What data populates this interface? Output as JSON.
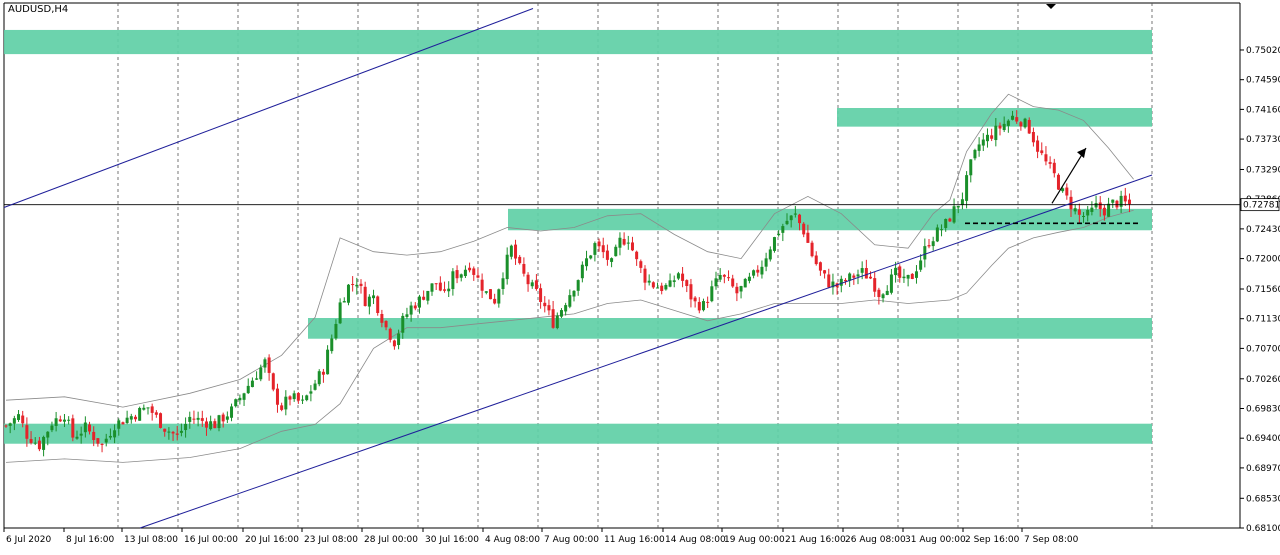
{
  "window": {
    "symbol_label": "AUDUSD,H4"
  },
  "colors": {
    "background": "#ffffff",
    "bull_candle": "#1a8f2a",
    "bear_candle": "#e4232a",
    "zone_fill": "#5fcfa6",
    "trendline": "#1f1f9a",
    "bollinger": "#8a8a8a",
    "grid": "#555555",
    "axis_text": "#000000"
  },
  "chart_data": {
    "type": "candlestick",
    "title": "AUDUSD,H4",
    "ylim": [
      0.681,
      0.757
    ],
    "grid": true,
    "y_ticks": [
      "0.75020",
      "0.74590",
      "0.74160",
      "0.73730",
      "0.73290",
      "0.72860",
      "0.72430",
      "0.72000",
      "0.71560",
      "0.71130",
      "0.70700",
      "0.70260",
      "0.69830",
      "0.69400",
      "0.68970",
      "0.68530",
      "0.68100"
    ],
    "x_ticks": [
      "6 Jul 2020",
      "8 Jul 16:00",
      "13 Jul 08:00",
      "16 Jul 00:00",
      "20 Jul 16:00",
      "23 Jul 08:00",
      "28 Jul 00:00",
      "30 Jul 16:00",
      "4 Aug 08:00",
      "7 Aug 00:00",
      "11 Aug 16:00",
      "14 Aug 08:00",
      "19 Aug 00:00",
      "21 Aug 16:00",
      "26 Aug 08:00",
      "31 Aug 00:00",
      "2 Sep 16:00",
      "7 Sep 08:00"
    ],
    "current_price": "0.72781",
    "horizontal_line": 0.72781,
    "zones": [
      {
        "name": "resistance-top",
        "low": 0.7496,
        "high": 0.7531
      },
      {
        "name": "resistance-high",
        "low": 0.7391,
        "high": 0.7418
      },
      {
        "name": "support-mid",
        "low": 0.7241,
        "high": 0.7272
      },
      {
        "name": "support-lower",
        "low": 0.7084,
        "high": 0.7114
      },
      {
        "name": "support-bottom",
        "low": 0.6932,
        "high": 0.6961
      }
    ],
    "trendlines": [
      {
        "name": "upper-channel",
        "points": [
          [
            "6 Jul 2020",
            0.7274
          ],
          [
            "30 Jul 16:00",
            0.7562
          ]
        ]
      },
      {
        "name": "lower-channel",
        "points": [
          [
            "13 Jul 08:00",
            0.681
          ],
          [
            "7 Sep 08:00",
            0.7321
          ]
        ]
      }
    ],
    "dashed_level": {
      "price": 0.7251,
      "from": "2 Sep 16:00",
      "to": "7 Sep 08:00"
    },
    "arrow": {
      "from": [
        "7 Sep 08:00",
        0.728
      ],
      "to": [
        "7 Sep 08:00",
        0.736
      ]
    },
    "close_path": [
      [
        0,
        0.6958
      ],
      [
        3,
        0.6972
      ],
      [
        5,
        0.6945
      ],
      [
        8,
        0.693
      ],
      [
        11,
        0.6963
      ],
      [
        14,
        0.6975
      ],
      [
        16,
        0.6942
      ],
      [
        19,
        0.6955
      ],
      [
        23,
        0.693
      ],
      [
        26,
        0.696
      ],
      [
        30,
        0.6972
      ],
      [
        34,
        0.6985
      ],
      [
        38,
        0.6955
      ],
      [
        41,
        0.6942
      ],
      [
        44,
        0.697
      ],
      [
        47,
        0.6965
      ],
      [
        50,
        0.696
      ],
      [
        54,
        0.698
      ],
      [
        57,
        0.7008
      ],
      [
        59,
        0.7025
      ],
      [
        62,
        0.705
      ],
      [
        64,
        0.7005
      ],
      [
        66,
        0.6985
      ],
      [
        68,
        0.7
      ],
      [
        71,
        0.699
      ],
      [
        74,
        0.702
      ],
      [
        76,
        0.704
      ],
      [
        78,
        0.7085
      ],
      [
        80,
        0.7135
      ],
      [
        82,
        0.716
      ],
      [
        84,
        0.7168
      ],
      [
        86,
        0.714
      ],
      [
        88,
        0.7145
      ],
      [
        91,
        0.71
      ],
      [
        93,
        0.708
      ],
      [
        95,
        0.711
      ],
      [
        97,
        0.713
      ],
      [
        99,
        0.714
      ],
      [
        101,
        0.7155
      ],
      [
        103,
        0.7165
      ],
      [
        105,
        0.7145
      ],
      [
        107,
        0.7175
      ],
      [
        109,
        0.718
      ],
      [
        111,
        0.7192
      ],
      [
        113,
        0.717
      ],
      [
        115,
        0.715
      ],
      [
        117,
        0.714
      ],
      [
        119,
        0.718
      ],
      [
        121,
        0.7215
      ],
      [
        123,
        0.7185
      ],
      [
        125,
        0.7165
      ],
      [
        127,
        0.715
      ],
      [
        129,
        0.713
      ],
      [
        131,
        0.7108
      ],
      [
        133,
        0.7128
      ],
      [
        135,
        0.715
      ],
      [
        137,
        0.7172
      ],
      [
        139,
        0.7198
      ],
      [
        141,
        0.722
      ],
      [
        143,
        0.7208
      ],
      [
        145,
        0.7192
      ],
      [
        147,
        0.7225
      ],
      [
        149,
        0.723
      ],
      [
        151,
        0.7195
      ],
      [
        153,
        0.7172
      ],
      [
        155,
        0.7162
      ],
      [
        157,
        0.7158
      ],
      [
        159,
        0.716
      ],
      [
        161,
        0.718
      ],
      [
        163,
        0.7155
      ],
      [
        165,
        0.7135
      ],
      [
        167,
        0.7132
      ],
      [
        169,
        0.7155
      ],
      [
        171,
        0.7175
      ],
      [
        173,
        0.7165
      ],
      [
        175,
        0.715
      ],
      [
        177,
        0.7162
      ],
      [
        179,
        0.7175
      ],
      [
        181,
        0.7192
      ],
      [
        183,
        0.7218
      ],
      [
        185,
        0.724
      ],
      [
        187,
        0.7255
      ],
      [
        189,
        0.7262
      ],
      [
        191,
        0.724
      ],
      [
        193,
        0.7205
      ],
      [
        195,
        0.718
      ],
      [
        197,
        0.7165
      ],
      [
        199,
        0.716
      ],
      [
        201,
        0.7168
      ],
      [
        203,
        0.7175
      ],
      [
        205,
        0.718
      ],
      [
        207,
        0.7172
      ],
      [
        209,
        0.715
      ],
      [
        211,
        0.7162
      ],
      [
        213,
        0.7178
      ],
      [
        215,
        0.7165
      ],
      [
        217,
        0.7175
      ],
      [
        219,
        0.72
      ],
      [
        221,
        0.7225
      ],
      [
        223,
        0.7238
      ],
      [
        225,
        0.725
      ],
      [
        227,
        0.727
      ],
      [
        229,
        0.729
      ],
      [
        231,
        0.7335
      ],
      [
        233,
        0.7365
      ],
      [
        235,
        0.7375
      ],
      [
        237,
        0.7385
      ],
      [
        239,
        0.7395
      ],
      [
        241,
        0.7405
      ],
      [
        243,
        0.74
      ],
      [
        245,
        0.7388
      ],
      [
        247,
        0.736
      ],
      [
        249,
        0.7338
      ],
      [
        251,
        0.732
      ],
      [
        253,
        0.7295
      ],
      [
        255,
        0.7278
      ],
      [
        257,
        0.7262
      ],
      [
        259,
        0.7262
      ],
      [
        261,
        0.7275
      ],
      [
        263,
        0.727
      ],
      [
        265,
        0.728
      ],
      [
        267,
        0.7282
      ],
      [
        269,
        0.7278
      ]
    ],
    "bollinger_upper": [
      [
        0,
        0.6995
      ],
      [
        14,
        0.7
      ],
      [
        28,
        0.6985
      ],
      [
        44,
        0.7005
      ],
      [
        56,
        0.7025
      ],
      [
        66,
        0.706
      ],
      [
        74,
        0.7115
      ],
      [
        80,
        0.723
      ],
      [
        88,
        0.721
      ],
      [
        96,
        0.7205
      ],
      [
        104,
        0.721
      ],
      [
        112,
        0.7225
      ],
      [
        120,
        0.7245
      ],
      [
        128,
        0.724
      ],
      [
        136,
        0.7245
      ],
      [
        144,
        0.7262
      ],
      [
        152,
        0.7265
      ],
      [
        160,
        0.7235
      ],
      [
        168,
        0.721
      ],
      [
        176,
        0.72
      ],
      [
        184,
        0.7265
      ],
      [
        192,
        0.729
      ],
      [
        200,
        0.7265
      ],
      [
        208,
        0.722
      ],
      [
        216,
        0.7215
      ],
      [
        222,
        0.7265
      ],
      [
        226,
        0.7285
      ],
      [
        230,
        0.7355
      ],
      [
        236,
        0.741
      ],
      [
        240,
        0.7438
      ],
      [
        246,
        0.742
      ],
      [
        252,
        0.7415
      ],
      [
        258,
        0.74
      ],
      [
        264,
        0.736
      ],
      [
        270,
        0.7315
      ]
    ],
    "bollinger_lower": [
      [
        0,
        0.6905
      ],
      [
        14,
        0.691
      ],
      [
        28,
        0.6905
      ],
      [
        44,
        0.6912
      ],
      [
        56,
        0.6925
      ],
      [
        66,
        0.695
      ],
      [
        74,
        0.696
      ],
      [
        80,
        0.699
      ],
      [
        88,
        0.707
      ],
      [
        96,
        0.71
      ],
      [
        104,
        0.71
      ],
      [
        112,
        0.7105
      ],
      [
        120,
        0.711
      ],
      [
        128,
        0.7115
      ],
      [
        136,
        0.712
      ],
      [
        144,
        0.7135
      ],
      [
        152,
        0.714
      ],
      [
        160,
        0.7125
      ],
      [
        168,
        0.711
      ],
      [
        176,
        0.712
      ],
      [
        184,
        0.7135
      ],
      [
        192,
        0.7135
      ],
      [
        200,
        0.7135
      ],
      [
        208,
        0.714
      ],
      [
        216,
        0.7135
      ],
      [
        222,
        0.7138
      ],
      [
        226,
        0.714
      ],
      [
        230,
        0.715
      ],
      [
        236,
        0.719
      ],
      [
        240,
        0.7215
      ],
      [
        246,
        0.723
      ],
      [
        252,
        0.7238
      ],
      [
        258,
        0.7245
      ],
      [
        264,
        0.726
      ],
      [
        270,
        0.727
      ]
    ]
  }
}
